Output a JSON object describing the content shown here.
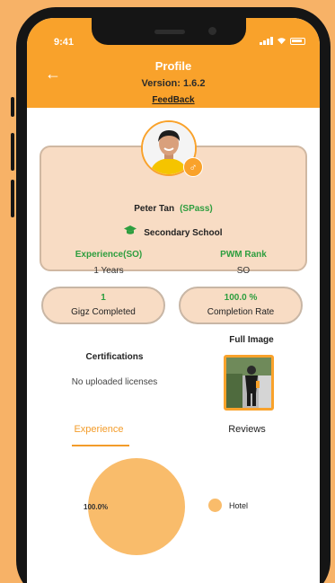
{
  "status_bar": {
    "time": "9:41"
  },
  "header": {
    "title": "Profile",
    "version": "Version: 1.6.2",
    "feedback": "FeedBack"
  },
  "profile": {
    "name": "Peter Tan",
    "pass_type": "(SPass)",
    "education": "Secondary School",
    "experience_label": "Experience(SO)",
    "experience_value": "1 Years",
    "rank_label": "PWM Rank",
    "rank_value": "SO"
  },
  "stats": [
    {
      "value": "1",
      "label": "Gigz Completed"
    },
    {
      "value": "100.0 %",
      "label": "Completion Rate"
    }
  ],
  "certifications": {
    "title": "Certifications",
    "empty_text": "No uploaded licenses"
  },
  "full_image": {
    "title": "Full Image"
  },
  "tabs": [
    {
      "label": "Experience",
      "active": true
    },
    {
      "label": "Reviews",
      "active": false
    }
  ],
  "chart_data": {
    "type": "pie",
    "slices": [
      {
        "label": "Hotel",
        "value": 100.0,
        "display": "100.0%",
        "color": "#F9BC6B"
      }
    ]
  },
  "colors": {
    "accent": "#F9A22B",
    "green": "#2E9E3F",
    "card": "#F8DCC4",
    "background": "#F7B267"
  },
  "icons": {
    "back": "arrow-left-icon",
    "gender": "male-icon",
    "education": "graduation-cap-icon"
  }
}
